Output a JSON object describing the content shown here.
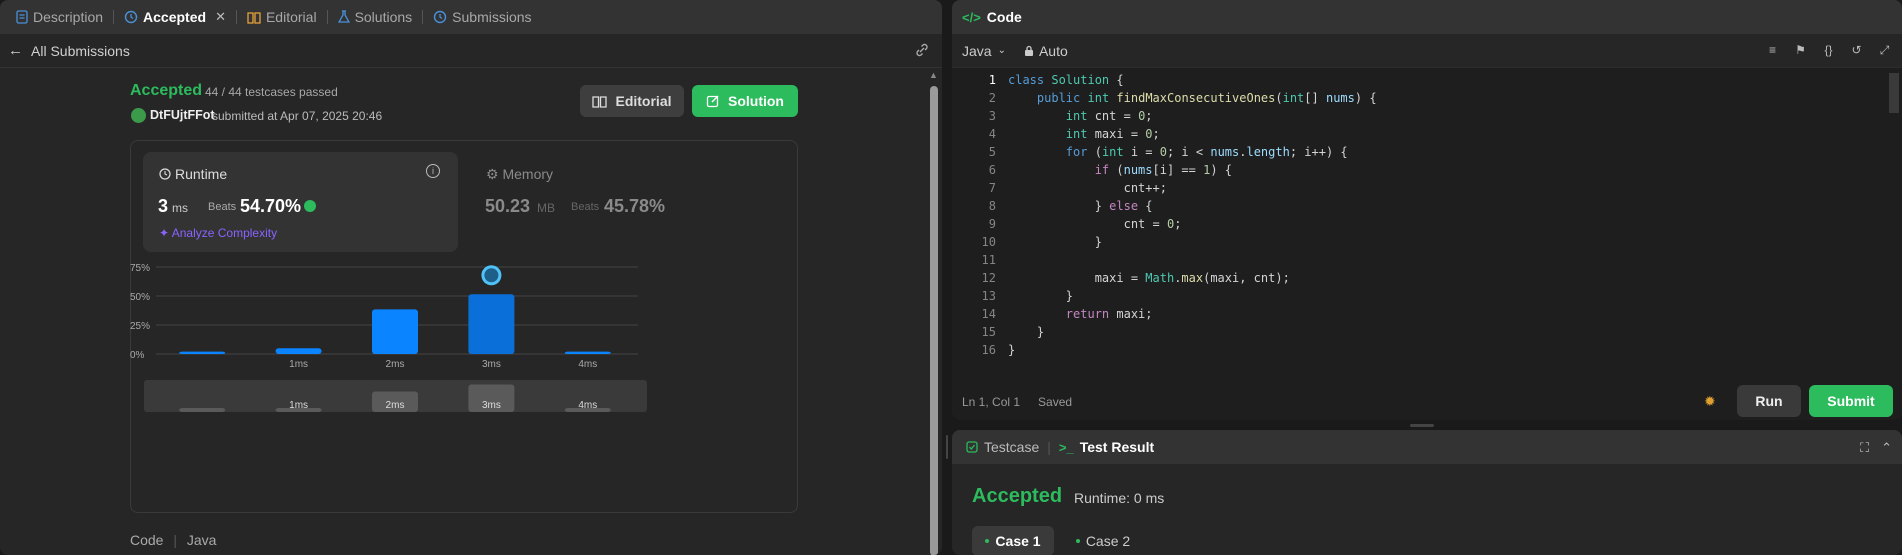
{
  "left_tabs": {
    "description": "Description",
    "accepted": "Accepted",
    "editorial": "Editorial",
    "solutions": "Solutions",
    "submissions": "Submissions"
  },
  "subheader": {
    "all_submissions": "All Submissions"
  },
  "submission": {
    "status": "Accepted",
    "testcases": "44 / 44 testcases passed",
    "user": "DtFUjtFFot",
    "submitted_text": "submitted at Apr 07, 2025 20:46"
  },
  "buttons": {
    "editorial": "Editorial",
    "solution": "Solution"
  },
  "runtime": {
    "label": "Runtime",
    "value": "3",
    "unit": "ms",
    "beats_label": "Beats",
    "beats_pct": "54.70%",
    "analyze": "Analyze Complexity"
  },
  "memory": {
    "label": "Memory",
    "value": "50.23",
    "unit": "MB",
    "beats_label": "Beats",
    "beats_pct": "45.78%"
  },
  "chart_data": {
    "type": "bar",
    "categories": [
      "",
      "1ms",
      "2ms",
      "3ms",
      "4ms"
    ],
    "values": [
      2,
      5,
      38.5,
      51.5,
      2
    ],
    "y_ticks": [
      "0%",
      "25%",
      "50%",
      "75%"
    ],
    "ylim": [
      0,
      75
    ],
    "highlight_category": "3ms",
    "grid": true,
    "colors": {
      "bar": "#0a84ff",
      "highlight": "#0a6fd8"
    },
    "mini_labels": [
      "",
      "1ms",
      "2ms",
      "3ms",
      "4ms"
    ]
  },
  "code_footer": {
    "label": "Code",
    "lang": "Java"
  },
  "code_panel": {
    "title": "Code",
    "language": "Java",
    "mode": "Auto",
    "lines": [
      "class Solution {",
      "    public int findMaxConsecutiveOnes(int[] nums) {",
      "        int cnt = 0;",
      "        int maxi = 0;",
      "        for (int i = 0; i < nums.length; i++) {",
      "            if (nums[i] == 1) {",
      "                cnt++;",
      "            } else {",
      "                cnt = 0;",
      "            }",
      "",
      "            maxi = Math.max(maxi, cnt);",
      "        }",
      "        return maxi;",
      "    }",
      "}"
    ],
    "line_numbers": [
      "1",
      "2",
      "3",
      "4",
      "5",
      "6",
      "7",
      "8",
      "9",
      "10",
      "11",
      "12",
      "13",
      "14",
      "15",
      "16"
    ],
    "cursor": "Ln 1, Col 1",
    "saved": "Saved",
    "run": "Run",
    "submit": "Submit"
  },
  "result_panel": {
    "testcase_tab": "Testcase",
    "result_tab": "Test Result",
    "status": "Accepted",
    "runtime": "Runtime: 0 ms",
    "case1": "Case 1",
    "case2": "Case 2"
  }
}
